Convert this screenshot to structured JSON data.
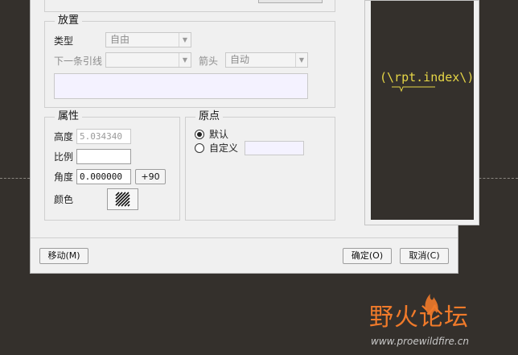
{
  "placement": {
    "title": "放置",
    "type_label": "类型",
    "type_value": "自由",
    "next_leader_label": "下一条引线",
    "next_leader_value": "",
    "arrow_label": "箭头",
    "arrow_value": "自动"
  },
  "attributes": {
    "title": "属性",
    "height_label": "高度",
    "height_value": "5.034340",
    "scale_label": "比例",
    "scale_value": "",
    "angle_label": "角度",
    "angle_value": "0.000000",
    "plus90_label": "+90",
    "color_label": "颜色"
  },
  "origin": {
    "title": "原点",
    "default_label": "默认",
    "custom_label": "自定义",
    "custom_value": ""
  },
  "preview": {
    "text": "(\\rpt.index\\)"
  },
  "footer": {
    "move_label": "移动(M)",
    "ok_label": "确定(O)",
    "cancel_label": "取消(C)"
  },
  "watermark": {
    "brand": "野火论坛",
    "url": "www.proewildfire.cn"
  },
  "colors": {
    "canvas": "#34302c",
    "preview_text": "#e6d646",
    "watermark": "#f07a2a"
  }
}
